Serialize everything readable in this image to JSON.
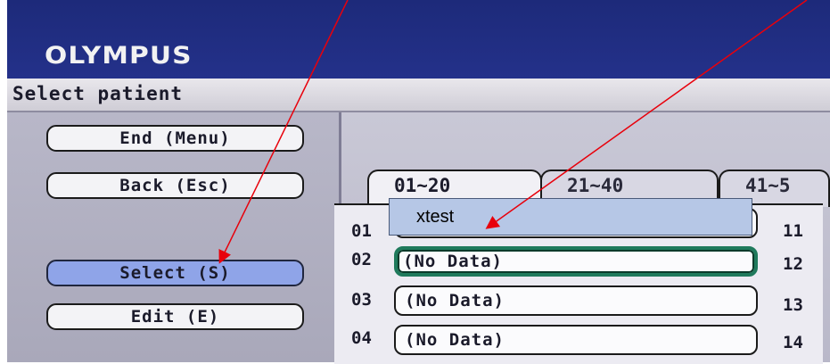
{
  "header": {
    "logo": "OLYMPUS",
    "title": "Select patient"
  },
  "left_buttons": {
    "end": "End (Menu)",
    "back": "Back (Esc)",
    "select": "Select (S)",
    "edit": "Edit (E)"
  },
  "tabs": [
    "01~20",
    "21~40",
    "41~5"
  ],
  "rows": [
    {
      "num": "01",
      "value": ""
    },
    {
      "num": "02",
      "value": "(No Data)"
    },
    {
      "num": "03",
      "value": "(No Data)"
    },
    {
      "num": "04",
      "value": "(No Data)"
    }
  ],
  "right_numbers": [
    "11",
    "12",
    "13",
    "14"
  ],
  "popup": {
    "text": "xtest"
  },
  "colors": {
    "annotation_arrow": "#e8000b",
    "selected_button": "#8fa4e8",
    "focus_border": "#1f7a5c"
  }
}
